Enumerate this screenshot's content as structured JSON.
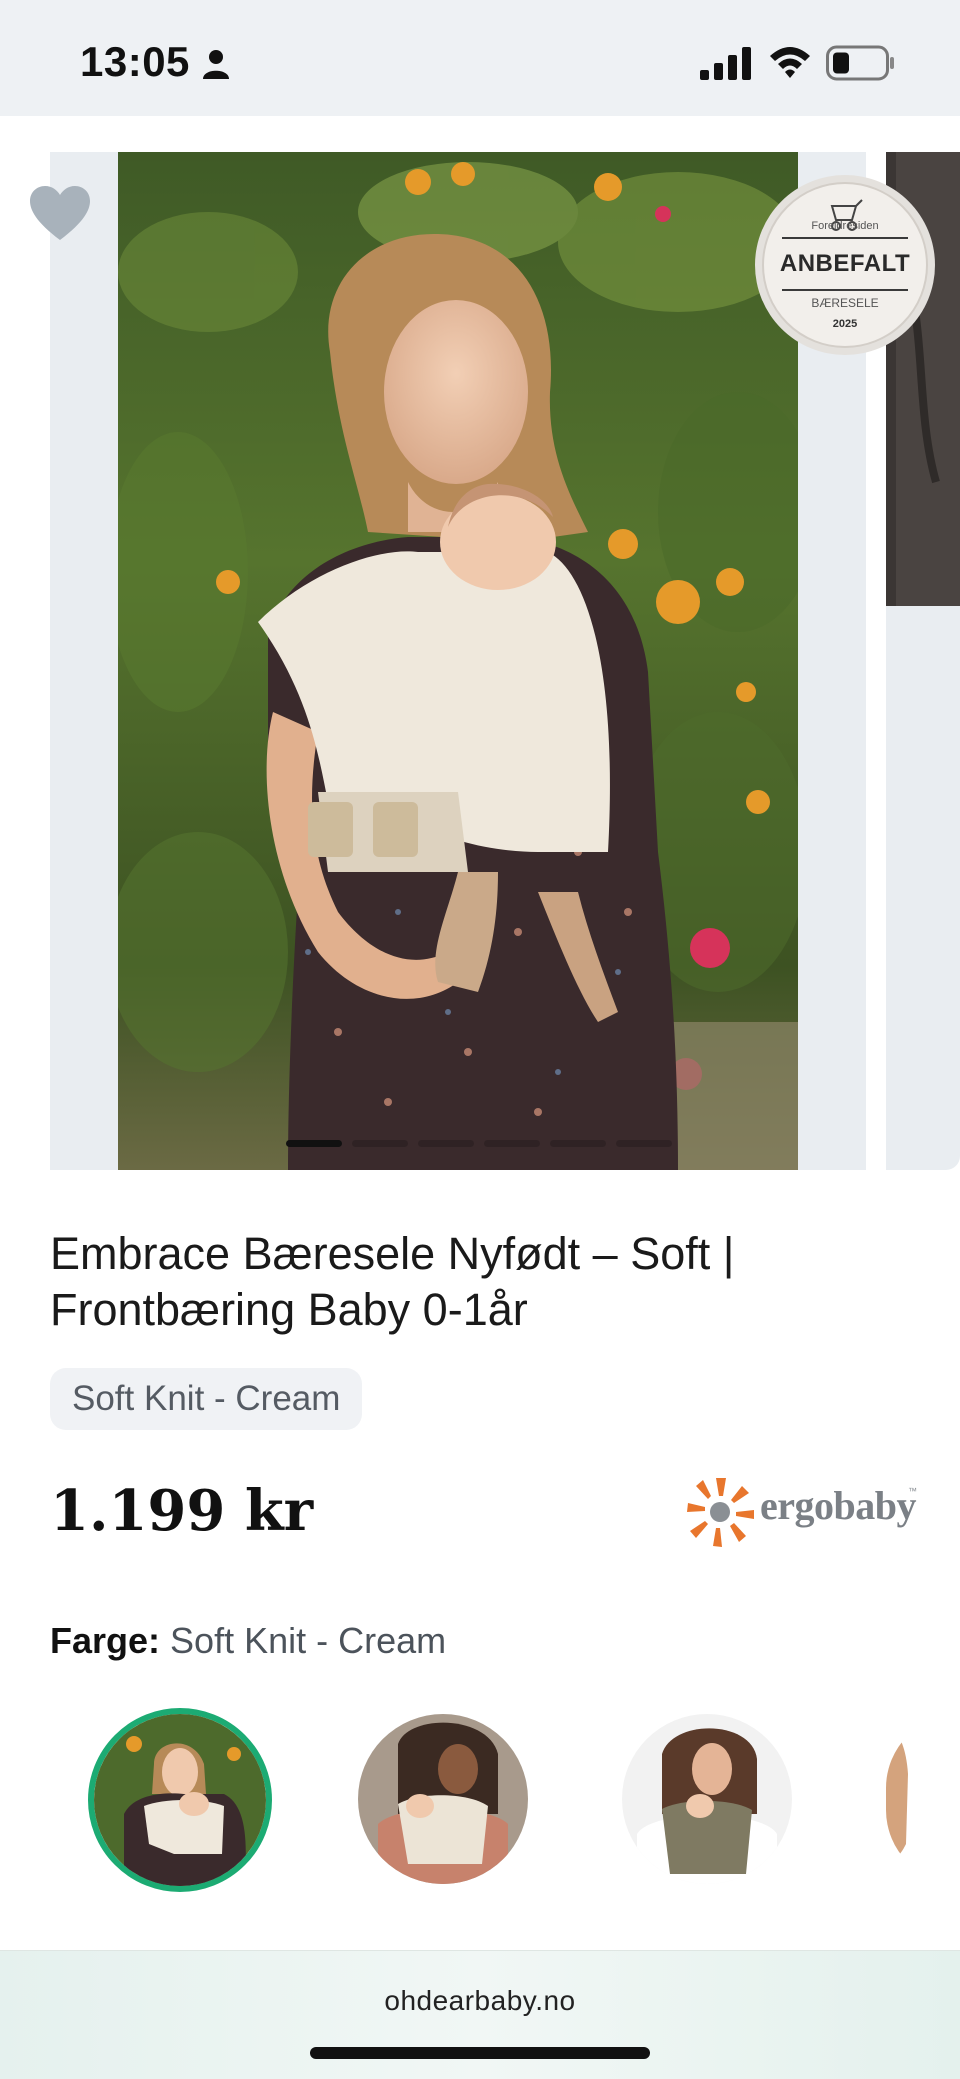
{
  "status_bar": {
    "time": "13:05",
    "icons": [
      "person-icon",
      "signal-icon",
      "wifi-icon",
      "battery-icon"
    ]
  },
  "gallery": {
    "favorite_icon": "heart-icon",
    "photo_count": 6,
    "active_index": 0,
    "award": {
      "source": "Foreldresiden",
      "title": "ANBEFALT",
      "category": "BÆRESELE",
      "year": "2025"
    }
  },
  "product": {
    "title_line1": "Embrace Bæresele Nyfødt – Soft |",
    "title_line2": "Frontbæring Baby 0-1år",
    "variant": "Soft Knit - Cream",
    "price": "1.199 kr",
    "brand": "ergobaby",
    "brand_tm": "™"
  },
  "color_picker": {
    "label": "Farge:",
    "value": "Soft Knit - Cream",
    "swatches": [
      {
        "name": "Soft Knit - Cream",
        "selected": true
      },
      {
        "name": "swatch-2",
        "selected": false
      },
      {
        "name": "swatch-3",
        "selected": false
      },
      {
        "name": "swatch-4",
        "selected": false
      }
    ]
  },
  "browser": {
    "url": "ohdearbaby.no"
  },
  "colors": {
    "accent_selected": "#1cab73",
    "brand_orange": "#e8762d",
    "chip_bg": "#f0f2f5"
  }
}
